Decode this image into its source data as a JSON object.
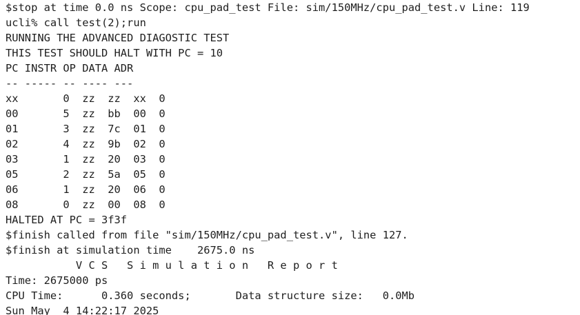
{
  "terminal": {
    "lines": [
      "$stop at time 0.0 ns Scope: cpu_pad_test File: sim/150MHz/cpu_pad_test.v Line: 119",
      "ucli% call test(2);run",
      "RUNNING THE ADVANCED DIAGOSTIC TEST",
      "THIS TEST SHOULD HALT WITH PC = 10",
      "PC INSTR OP DATA ADR",
      "-- ----- -- ---- ---",
      "xx       0  zz  zz  xx  0",
      "00       5  zz  bb  00  0",
      "01       3  zz  7c  01  0",
      "02       4  zz  9b  02  0",
      "03       1  zz  20  03  0",
      "05       2  zz  5a  05  0",
      "06       1  zz  20  06  0",
      "08       0  zz  00  08  0",
      "HALTED AT PC = 3f3f",
      "$finish called from file \"sim/150MHz/cpu_pad_test.v\", line 127.",
      "$finish at simulation time    2675.0 ns",
      "           V C S   S i m u l a t i o n   R e p o r t",
      "Time: 2675000 ps",
      "CPU Time:      0.360 seconds;       Data structure size:   0.0Mb",
      "Sun May  4 14:22:17 2025"
    ]
  }
}
